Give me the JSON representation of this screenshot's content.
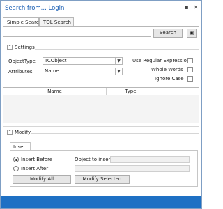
{
  "window": {
    "title": "Search from... Login"
  },
  "tabs": [
    {
      "label": "Simple Search"
    },
    {
      "label": "TQL Search"
    }
  ],
  "search": {
    "value": "",
    "button_label": "Search"
  },
  "settings": {
    "heading": "Settings",
    "object_type_label": "ObjectType",
    "object_type_value": "TCObject",
    "attributes_label": "Attributes",
    "attributes_value": "Name",
    "options": [
      {
        "label": "Use Regular Expression",
        "checked": false
      },
      {
        "label": "Whole Words",
        "checked": false
      },
      {
        "label": "Ignore Case",
        "checked": false
      }
    ]
  },
  "results": {
    "columns": [
      "Name",
      "Type"
    ],
    "rows": []
  },
  "modify": {
    "heading": "Modify",
    "tab_label": "Insert",
    "insert_before_label": "Insert Before",
    "insert_after_label": "Insert After",
    "selected_position": "Insert Before",
    "object_to_insert_label": "Object to insert:",
    "object_to_insert_value": "",
    "second_value": "",
    "modify_all_label": "Modify All",
    "modify_selected_label": "Modify Selected"
  },
  "colors": {
    "accent": "#1e70c4",
    "title": "#1a5fb4"
  }
}
